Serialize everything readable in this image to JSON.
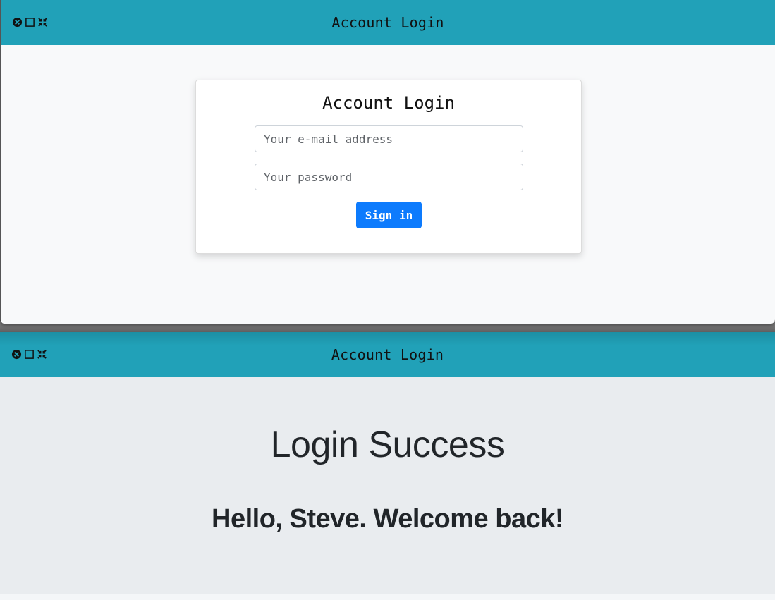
{
  "login_window": {
    "title": "Account Login",
    "card": {
      "title": "Account Login",
      "email_placeholder": "Your e-mail address",
      "email_value": "",
      "password_placeholder": "Your password",
      "password_value": "",
      "signin_label": "Sign in"
    }
  },
  "success_window": {
    "title": "Account Login",
    "heading": "Login Success",
    "message": "Hello, Steve. Welcome back!"
  },
  "colors": {
    "titlebar": "#21a1b8",
    "primary_button": "#0d7bfd",
    "login_background": "#f8f9fa",
    "success_background": "#e9ecef"
  },
  "icons": [
    "close-icon",
    "maximize-icon",
    "fullscreen-icon"
  ]
}
